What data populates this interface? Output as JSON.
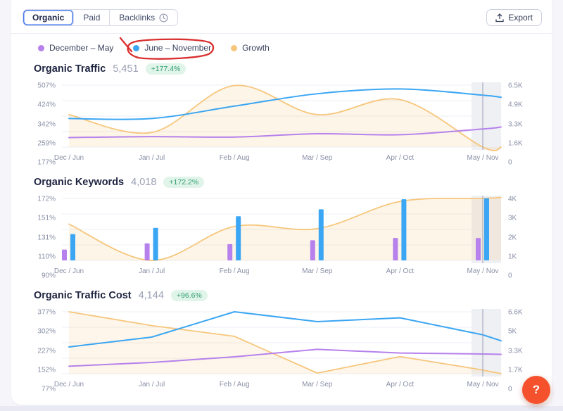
{
  "toolbar": {
    "tabs": [
      {
        "label": "Organic",
        "selected": true
      },
      {
        "label": "Paid",
        "selected": false
      },
      {
        "label": "Backlinks",
        "selected": false,
        "icon": "clock-badge-icon"
      }
    ],
    "export_label": "Export"
  },
  "legend": {
    "items": [
      {
        "label": "December – May",
        "color": "#b681ec",
        "annotated": false
      },
      {
        "label": "June – November",
        "color": "#3ba6f3",
        "annotated": true
      },
      {
        "label": "Growth",
        "color": "#f6c67c",
        "annotated": false
      }
    ],
    "annotation_color": "#d92f2f"
  },
  "sections": [
    {
      "title": "Organic Traffic",
      "value": "5,451",
      "change": "+177.4%"
    },
    {
      "title": "Organic Keywords",
      "value": "4,018",
      "change": "+172.2%"
    },
    {
      "title": "Organic Traffic Cost",
      "value": "4,144",
      "change": "+96.6%"
    }
  ],
  "chart_data": [
    {
      "type": "area",
      "title": "Organic Traffic",
      "categories": [
        "Dec / Jun",
        "Jan / Jul",
        "Feb / Aug",
        "Mar / Sep",
        "Apr / Oct",
        "May / Nov"
      ],
      "left_axis": {
        "ticks": [
          "507%",
          "424%",
          "342%",
          "259%",
          "177%"
        ],
        "range": [
          177,
          507
        ]
      },
      "right_axis": {
        "ticks": [
          "6.5K",
          "4.9K",
          "3.3K",
          "1.6K",
          "0"
        ],
        "range": [
          0,
          6500
        ]
      },
      "grid": true,
      "legend_position": "top",
      "highlight_last": true,
      "series": [
        {
          "name": "Growth",
          "kind": "line",
          "axis": "left",
          "smooth": true,
          "area": true,
          "color": "#f6c67c",
          "fill": "rgba(246,198,124,0.18)",
          "values": [
            350,
            255,
            505,
            350,
            430,
            177
          ]
        },
        {
          "name": "December – May",
          "kind": "line",
          "axis": "right",
          "smooth": true,
          "color": "#b681ec",
          "values": [
            1000,
            1100,
            1050,
            1400,
            1300,
            1900
          ]
        },
        {
          "name": "June – November",
          "kind": "line",
          "axis": "right",
          "smooth": true,
          "color": "#3ba6f3",
          "values": [
            3000,
            3000,
            4300,
            5600,
            6100,
            5451
          ]
        }
      ]
    },
    {
      "type": "bar",
      "title": "Organic Keywords",
      "categories": [
        "Dec / Jun",
        "Jan / Jul",
        "Feb / Aug",
        "Mar / Sep",
        "Apr / Oct",
        "May / Nov"
      ],
      "left_axis": {
        "ticks": [
          "172%",
          "151%",
          "131%",
          "110%",
          "90%"
        ],
        "range": [
          90,
          172
        ]
      },
      "right_axis": {
        "ticks": [
          "4K",
          "3K",
          "2K",
          "1K",
          "0"
        ],
        "range": [
          0,
          4000
        ]
      },
      "grid": true,
      "legend_position": "top",
      "highlight_last": true,
      "series": [
        {
          "name": "Growth",
          "kind": "line",
          "axis": "left",
          "smooth": true,
          "area": true,
          "color": "#f6c67c",
          "fill": "rgba(246,198,124,0.18)",
          "values": [
            138,
            90,
            135,
            132,
            168,
            172
          ]
        },
        {
          "name": "December – May",
          "kind": "bar",
          "axis": "right",
          "color": "#b681ec",
          "values": [
            700,
            1100,
            1050,
            1300,
            1450,
            1450
          ]
        },
        {
          "name": "June – November",
          "kind": "bar",
          "axis": "right",
          "color": "#3ba6f3",
          "values": [
            1700,
            2100,
            2850,
            3300,
            3950,
            4018
          ]
        }
      ]
    },
    {
      "type": "line",
      "title": "Organic Traffic Cost",
      "categories": [
        "Dec / Jun",
        "Jan / Jul",
        "Feb / Aug",
        "Mar / Sep",
        "Apr / Oct",
        "May / Nov"
      ],
      "left_axis": {
        "ticks": [
          "377%",
          "302%",
          "227%",
          "152%",
          "77%"
        ],
        "range": [
          77,
          377
        ]
      },
      "right_axis": {
        "ticks": [
          "6.6K",
          "5K",
          "3.3K",
          "1.7K",
          "0"
        ],
        "range": [
          0,
          6600
        ]
      },
      "grid": true,
      "legend_position": "top",
      "highlight_last": true,
      "series": [
        {
          "name": "Growth",
          "kind": "line",
          "axis": "left",
          "smooth": false,
          "area": true,
          "color": "#f6c67c",
          "fill": "rgba(246,198,124,0.16)",
          "values": [
            377,
            310,
            258,
            80,
            160,
            95
          ]
        },
        {
          "name": "December – May",
          "kind": "line",
          "axis": "right",
          "smooth": false,
          "color": "#b681ec",
          "values": [
            800,
            1200,
            1800,
            2600,
            2200,
            2100
          ]
        },
        {
          "name": "June – November",
          "kind": "line",
          "axis": "right",
          "smooth": false,
          "color": "#3ba6f3",
          "values": [
            2850,
            3900,
            6600,
            5550,
            5950,
            4144
          ]
        }
      ]
    }
  ],
  "colors": {
    "accent_blue": "#4a7cf0",
    "series_purple": "#b681ec",
    "series_blue": "#3ba6f3",
    "series_orange": "#f6c67c",
    "badge_green_bg": "#e1f4ea",
    "badge_green_text": "#2e9c70",
    "annotation_red": "#d92f2f",
    "help_button": "#f4512c",
    "grid_line": "#edeff5",
    "highlight_band": "rgba(140,148,178,0.14)"
  },
  "help": {
    "label": "?"
  }
}
